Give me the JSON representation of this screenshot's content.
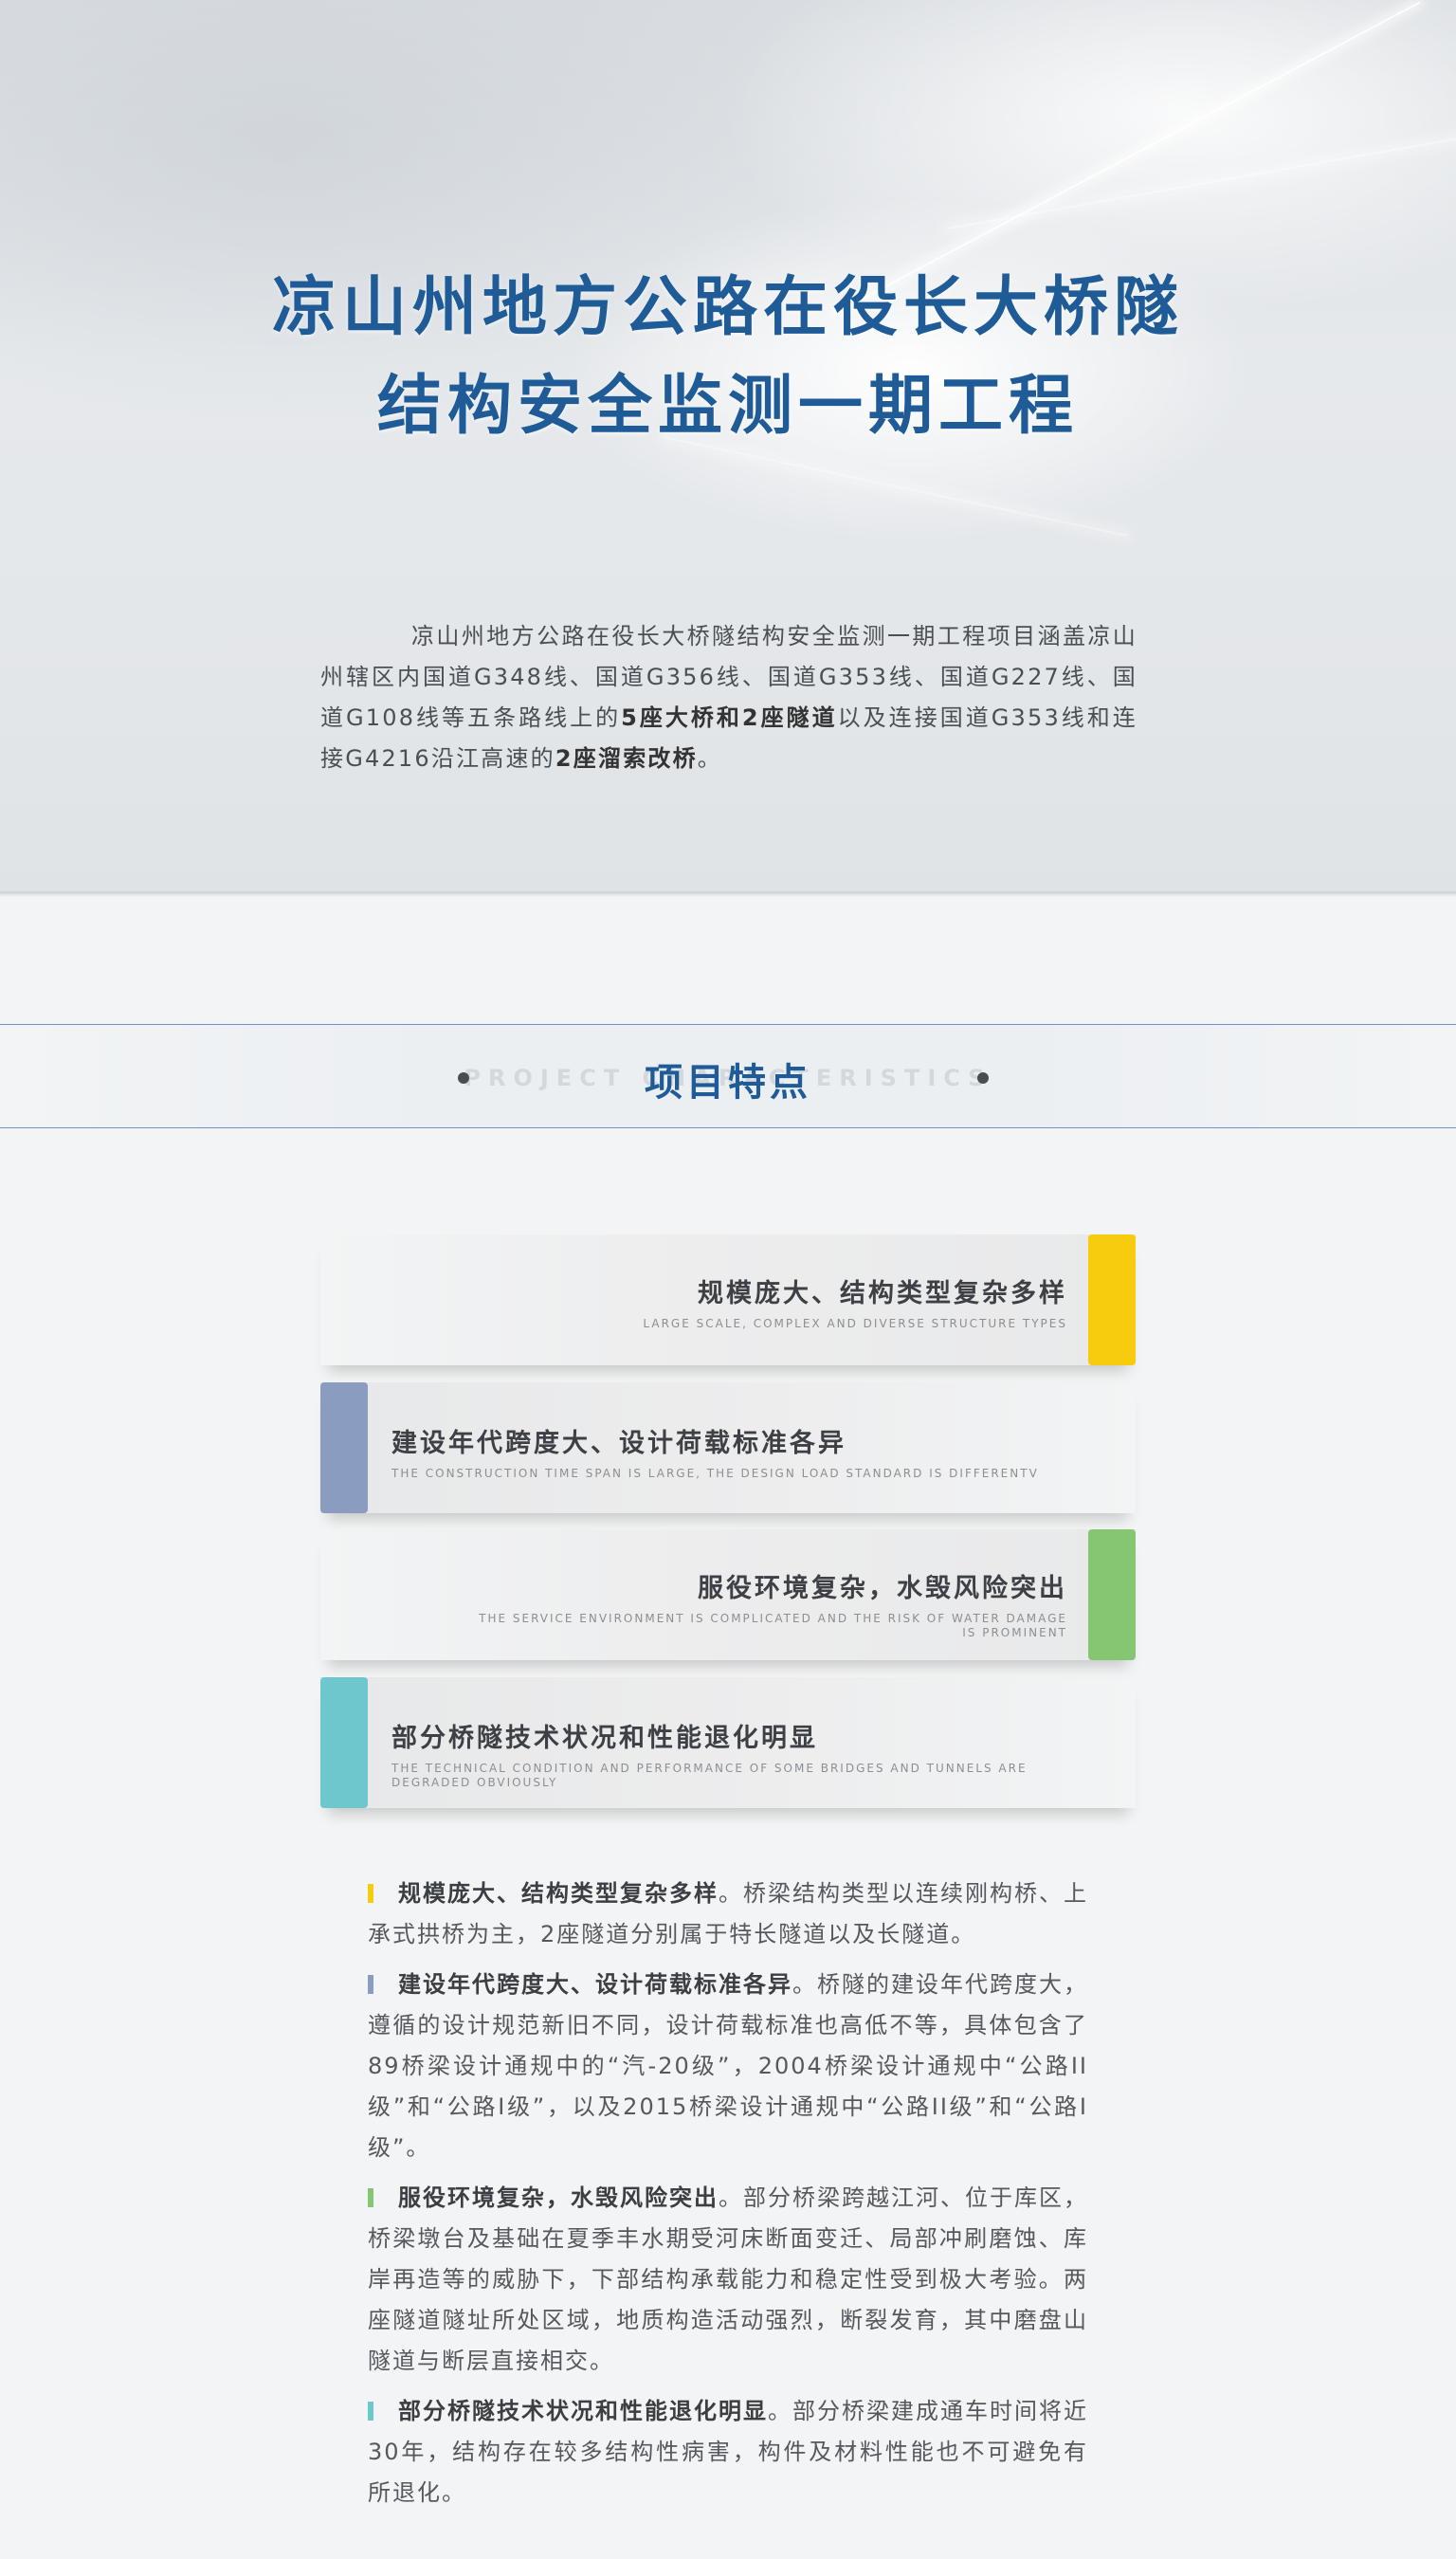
{
  "hero": {
    "title_line1": "凉山州地方公路在役长大桥隧",
    "title_line2": "结构安全监测一期工程",
    "intro_part1": "凉山州地方公路在役长大桥隧结构安全监测一期工程项目涵盖凉山州辖区内国道G348线、国道G356线、国道G353线、国道G227线、国道G108线等五条路线上的",
    "intro_bold1": "5座大桥和2座隧道",
    "intro_part2": "以及连接国道G353线和连接G4216沿江高速的",
    "intro_bold2": "2座溜索改桥",
    "intro_part3": "。"
  },
  "section": {
    "title": "项目特点",
    "bg_text": "PROJECT CHARACTERISTICS"
  },
  "cards": [
    {
      "title": "规模庞大、结构类型复杂多样",
      "subtitle": "LARGE SCALE, COMPLEX AND DIVERSE STRUCTURE TYPES",
      "color": "#f7cc0f",
      "side": "right"
    },
    {
      "title": "建设年代跨度大、设计荷载标准各异",
      "subtitle": "THE CONSTRUCTION TIME SPAN IS LARGE, THE DESIGN LOAD STANDARD IS DIFFERENTV",
      "color": "#8a9cbf",
      "side": "left"
    },
    {
      "title": "服役环境复杂，水毁风险突出",
      "subtitle": "THE SERVICE ENVIRONMENT IS COMPLICATED AND THE RISK OF WATER DAMAGE IS PROMINENT",
      "color": "#86c672",
      "side": "right"
    },
    {
      "title": "部分桥隧技术状况和性能退化明显",
      "subtitle": "THE TECHNICAL CONDITION AND PERFORMANCE OF SOME BRIDGES AND TUNNELS ARE DEGRADED OBVIOUSLY",
      "color": "#6ec7cc",
      "side": "left"
    }
  ],
  "details": [
    {
      "lead": "规模庞大、结构类型复杂多样",
      "text": "。桥梁结构类型以连续刚构桥、上承式拱桥为主，2座隧道分别属于特长隧道以及长隧道。",
      "color": "#f7cc0f"
    },
    {
      "lead": "建设年代跨度大、设计荷载标准各异",
      "text": "。桥隧的建设年代跨度大，遵循的设计规范新旧不同，设计荷载标准也高低不等，具体包含了89桥梁设计通规中的“汽-20级”，2004桥梁设计通规中“公路II级”和“公路I级”，以及2015桥梁设计通规中“公路II级”和“公路I级”。",
      "color": "#8a9cbf"
    },
    {
      "lead": "服役环境复杂，水毁风险突出",
      "text": "。部分桥梁跨越江河、位于库区，桥梁墩台及基础在夏季丰水期受河床断面变迁、局部冲刷磨蚀、库岸再造等的威胁下，下部结构承载能力和稳定性受到极大考验。两座隧道隧址所处区域，地质构造活动强烈，断裂发育，其中磨盘山隧道与断层直接相交。",
      "color": "#86c672"
    },
    {
      "lead": "部分桥隧技术状况和性能退化明显",
      "text": "。部分桥梁建成通车时间将近30年，结构存在较多结构性病害，构件及材料性能也不可避免有所退化。",
      "color": "#6ec7cc"
    }
  ]
}
